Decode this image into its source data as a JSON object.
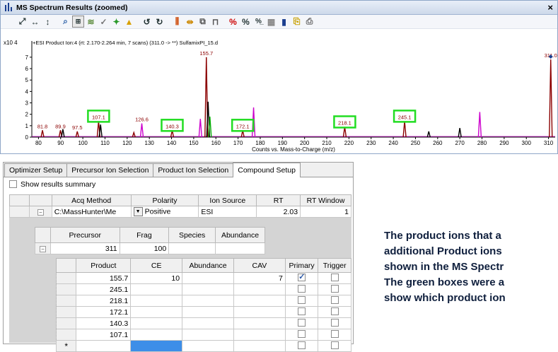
{
  "spectrum_window": {
    "title": "MS Spectrum Results (zoomed)",
    "close_label": "×",
    "plot_header": "+ESI Product Ion:4 (rt: 2.170-2.264 min, 7 scans) (311.0 -> **) SulfamixPI_15.d",
    "y_multiplier": "x10 4",
    "x_axis_label": "Counts vs. Mass-to-Charge (m/z)"
  },
  "toolbar": {
    "tools": [
      "pan-arrows",
      "x-expand",
      "y-expand",
      "zoom",
      "autoscale",
      "normalize",
      "select-peaks",
      "label-peaks",
      "chart-peaks",
      "undo",
      "redo",
      "bar-spectrum",
      "x-range",
      "compare",
      "overlay",
      "percent",
      "percent-normalize",
      "grid",
      "bar-chart",
      "copy",
      "print"
    ]
  },
  "chart_data": {
    "type": "bar",
    "x_range": [
      77,
      313
    ],
    "y_range": [
      0,
      7.8
    ],
    "x_ticks": [
      80,
      90,
      100,
      110,
      120,
      130,
      140,
      150,
      160,
      170,
      180,
      190,
      200,
      210,
      220,
      230,
      240,
      250,
      260,
      270,
      280,
      290,
      300,
      310
    ],
    "y_ticks": [
      0,
      1,
      2,
      3,
      4,
      5,
      6,
      7
    ],
    "xlabel": "Counts vs. Mass-to-Charge (m/z)",
    "peaks": [
      {
        "mz": 81.8,
        "y": 0.6,
        "color": "#8b0000",
        "label": "81.8"
      },
      {
        "mz": 89.9,
        "y": 0.6,
        "color": "#8b0000",
        "label": "89.9"
      },
      {
        "mz": 91.0,
        "y": 0.7,
        "color": "#000000",
        "label": ""
      },
      {
        "mz": 97.5,
        "y": 0.5,
        "color": "#8b0000",
        "label": "97.5"
      },
      {
        "mz": 107.1,
        "y": 1.4,
        "color": "#8b0000",
        "label": "107.1"
      },
      {
        "mz": 108.0,
        "y": 1.1,
        "color": "#000000",
        "label": ""
      },
      {
        "mz": 123.0,
        "y": 0.4,
        "color": "#8b0000",
        "label": ""
      },
      {
        "mz": 126.6,
        "y": 1.2,
        "color": "#cc00cc",
        "label": "126.6"
      },
      {
        "mz": 140.3,
        "y": 0.6,
        "color": "#8b0000",
        "label": "140.3"
      },
      {
        "mz": 153.0,
        "y": 1.6,
        "color": "#cc00cc",
        "label": ""
      },
      {
        "mz": 155.7,
        "y": 7.0,
        "color": "#8b0000",
        "label": "155.7"
      },
      {
        "mz": 156.5,
        "y": 3.1,
        "color": "#000000",
        "label": ""
      },
      {
        "mz": 157.3,
        "y": 1.8,
        "color": "#00aa00",
        "label": ""
      },
      {
        "mz": 172.1,
        "y": 0.6,
        "color": "#8b0000",
        "label": "172.1"
      },
      {
        "mz": 177.0,
        "y": 2.6,
        "color": "#cc00cc",
        "label": ""
      },
      {
        "mz": 218.1,
        "y": 0.9,
        "color": "#8b0000",
        "label": "218.1"
      },
      {
        "mz": 245.1,
        "y": 1.4,
        "color": "#8b0000",
        "label": "245.1"
      },
      {
        "mz": 256.0,
        "y": 0.5,
        "color": "#000000",
        "label": ""
      },
      {
        "mz": 270.0,
        "y": 0.8,
        "color": "#000000",
        "label": ""
      },
      {
        "mz": 279.0,
        "y": 2.2,
        "color": "#cc00cc",
        "label": ""
      },
      {
        "mz": 311.0,
        "y": 6.8,
        "color": "#8b0000",
        "label": "311.0"
      }
    ],
    "highlight_boxes": [
      "107.1",
      "140.3",
      "172.1",
      "218.1",
      "245.1"
    ],
    "highlight_color": "#22dd22"
  },
  "optimizer": {
    "tabs": [
      "Optimizer Setup",
      "Precursor Ion Selection",
      "Product Ion Selection",
      "Compound Setup"
    ],
    "active_tab": 3,
    "summary_label": "Show results summary",
    "method_headers": [
      "Acq Method",
      "Polarity",
      "Ion Source",
      "RT",
      "RT Window"
    ],
    "method_row": {
      "acq_method": "C:\\MassHunter\\Me",
      "polarity": "Positive",
      "ion_source": "ESI",
      "rt": "2.03",
      "rt_window": "1"
    },
    "precursor_headers": [
      "Precursor",
      "Frag",
      "Species",
      "Abundance"
    ],
    "precursor_row": {
      "precursor": "311",
      "frag": "100",
      "species": "",
      "abundance": ""
    },
    "product_headers": [
      "Product",
      "CE",
      "Abundance",
      "CAV",
      "Primary",
      "Trigger"
    ],
    "products": [
      {
        "product": "155.7",
        "ce": "10",
        "abundance": "",
        "cav": "7",
        "primary": true,
        "trigger": false
      },
      {
        "product": "245.1",
        "ce": "",
        "abundance": "",
        "cav": "",
        "primary": false,
        "trigger": false
      },
      {
        "product": "218.1",
        "ce": "",
        "abundance": "",
        "cav": "",
        "primary": false,
        "trigger": false
      },
      {
        "product": "172.1",
        "ce": "",
        "abundance": "",
        "cav": "",
        "primary": false,
        "trigger": false
      },
      {
        "product": "140.3",
        "ce": "",
        "abundance": "",
        "cav": "",
        "primary": false,
        "trigger": false
      },
      {
        "product": "107.1",
        "ce": "",
        "abundance": "",
        "cav": "",
        "primary": false,
        "trigger": false
      }
    ],
    "new_row_marker": "*"
  },
  "note_lines": [
    "The product ions that a",
    "additional Product ions",
    "shown in the MS Spectr",
    "The green boxes were a",
    "show which product ion"
  ]
}
